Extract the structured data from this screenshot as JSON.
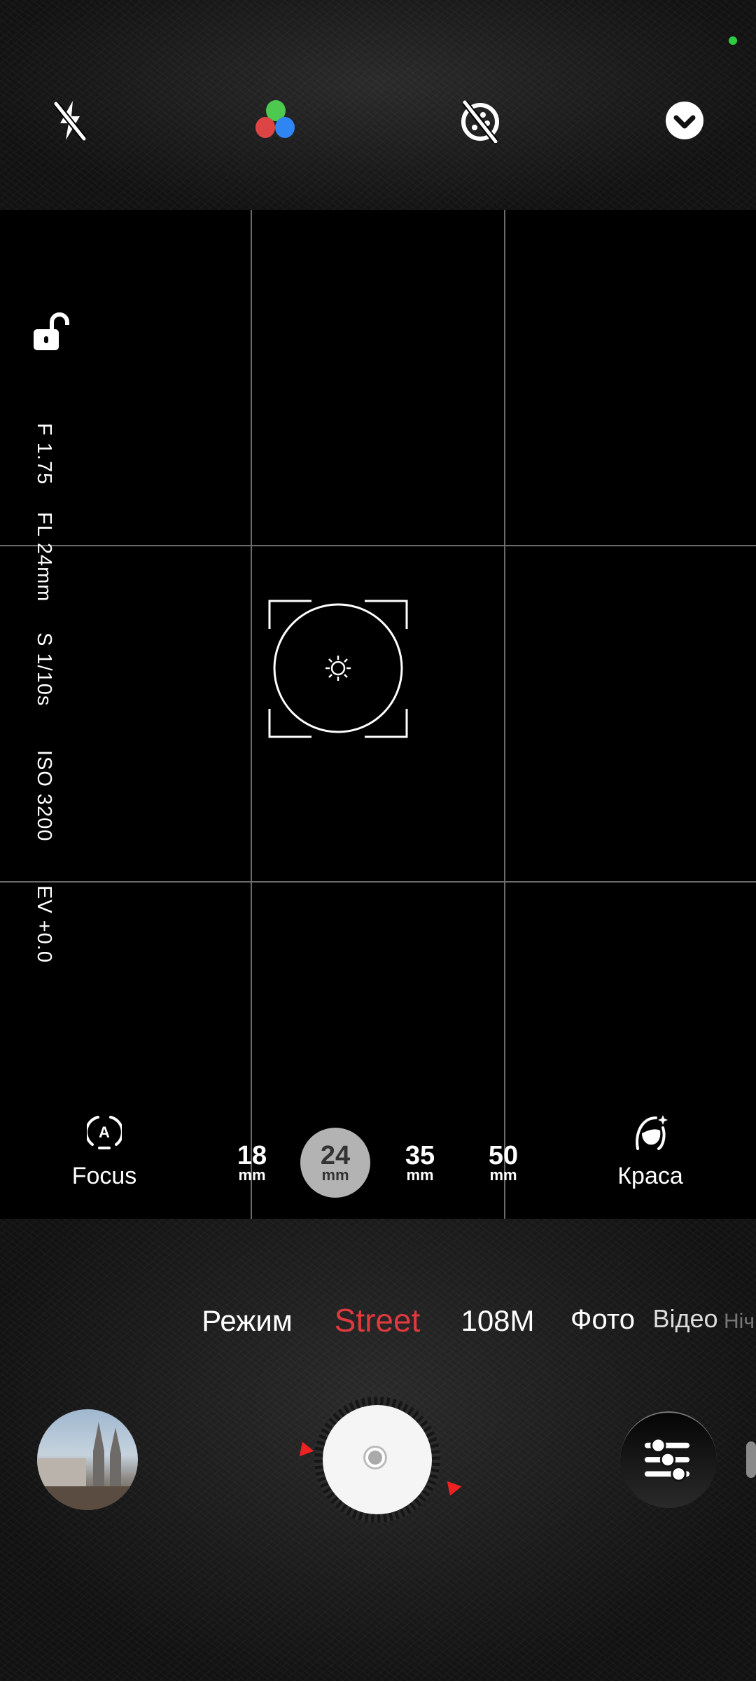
{
  "top_bar": {
    "icons": [
      "flash-off-icon",
      "color-filter-icon",
      "live-photo-off-icon",
      "chevron-down-icon"
    ],
    "status_dot_color": "#2ecc40"
  },
  "viewfinder": {
    "exposure_lock_icon": "unlock-icon",
    "info": {
      "aperture": "F 1.75",
      "focal_length": "FL 24mm",
      "shutter": "S 1/10s",
      "iso": "ISO 3200",
      "ev": "EV +0.0"
    },
    "focus_icon": "sun-icon"
  },
  "controls": {
    "focus": {
      "label": "Focus",
      "icon": "auto-focus-icon"
    },
    "beauty": {
      "label": "Краса",
      "icon": "beauty-face-icon"
    },
    "zoom_levels": [
      {
        "value": "18",
        "unit": "mm"
      },
      {
        "value": "24",
        "unit": "mm",
        "selected": true
      },
      {
        "value": "35",
        "unit": "mm"
      },
      {
        "value": "50",
        "unit": "mm"
      }
    ]
  },
  "modes": {
    "items": [
      "Режим",
      "Street",
      "108M",
      "Фото",
      "Відео",
      "Ніч"
    ],
    "selected": "Street",
    "accent_color": "#e0393e"
  },
  "bottom": {
    "gallery_icon": "gallery-thumbnail",
    "shutter_icon": "shutter-button",
    "settings_icon": "sliders-icon"
  }
}
